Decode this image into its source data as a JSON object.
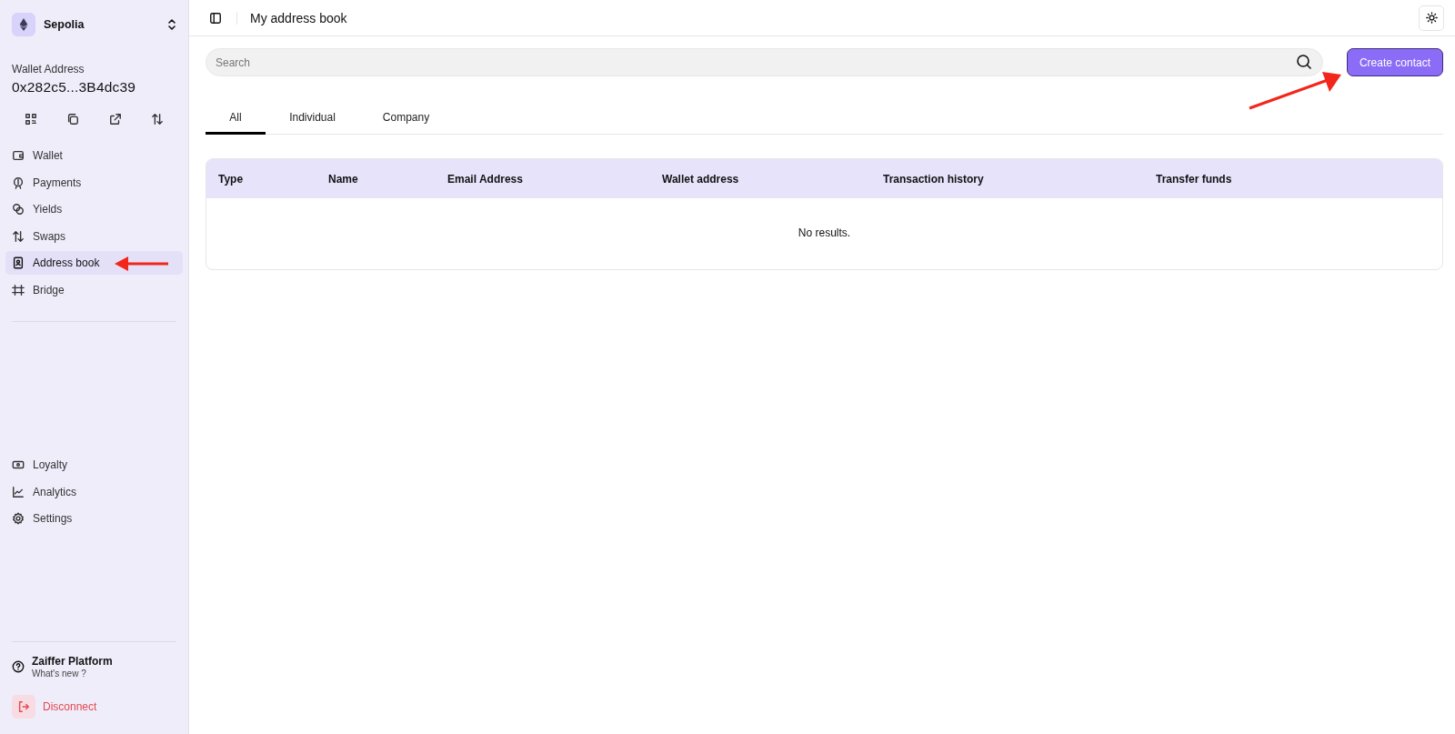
{
  "sidebar": {
    "network": {
      "name": "Sepolia"
    },
    "wallet": {
      "label": "Wallet Address",
      "address": "0x282c5...3B4dc39"
    },
    "actions": [
      {
        "kind": "qr"
      },
      {
        "kind": "copy"
      },
      {
        "kind": "external"
      },
      {
        "kind": "swap"
      }
    ],
    "nav_items": [
      {
        "label": "Wallet",
        "selected": false
      },
      {
        "label": "Payments",
        "selected": false
      },
      {
        "label": "Yields",
        "selected": false
      },
      {
        "label": "Swaps",
        "selected": false
      },
      {
        "label": "Address book",
        "selected": true
      },
      {
        "label": "Bridge",
        "selected": false
      }
    ],
    "bottom_items": [
      {
        "label": "Loyalty",
        "selected": false
      },
      {
        "label": "Analytics",
        "selected": false
      },
      {
        "label": "Settings",
        "selected": false
      }
    ],
    "platform": {
      "title": "Zaiffer Platform",
      "subtitle": "What's new ?"
    },
    "disconnect": "Disconnect"
  },
  "header": {
    "title": "My address book"
  },
  "search": {
    "placeholder": "Search"
  },
  "create_button": "Create contact",
  "tabs": [
    {
      "label": "All",
      "selected": true
    },
    {
      "label": "Individual",
      "selected": false
    },
    {
      "label": "Company",
      "selected": false
    }
  ],
  "table": {
    "columns": [
      "Type",
      "Name",
      "Email Address",
      "Wallet address",
      "Transaction history",
      "Transfer funds"
    ],
    "empty_message": "No results."
  },
  "annotations": [
    {
      "kind": "arrow-left"
    },
    {
      "kind": "arrow-up-right"
    }
  ]
}
